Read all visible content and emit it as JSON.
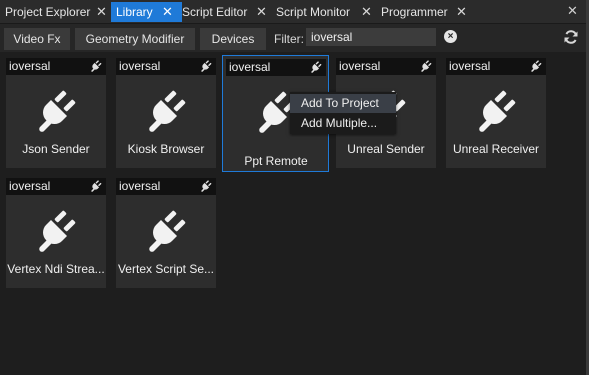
{
  "tabs": [
    {
      "label": "Project Explorer",
      "close": "✕"
    },
    {
      "label": "Library",
      "close": "✕"
    },
    {
      "label": "Script Editor",
      "close": "✕"
    },
    {
      "label": "Script Monitor",
      "close": "✕"
    },
    {
      "label": "Programmer",
      "close": "✕"
    }
  ],
  "window_close": "✕",
  "filters": {
    "buttons": [
      "Video Fx",
      "Geometry Modifier",
      "Devices"
    ],
    "label": "Filter:",
    "value": "ioversal",
    "clear_glyph": "×"
  },
  "cards": [
    {
      "vendor": "ioversal",
      "name": "Json Sender"
    },
    {
      "vendor": "ioversal",
      "name": "Kiosk Browser"
    },
    {
      "vendor": "ioversal",
      "name": "Ppt Remote"
    },
    {
      "vendor": "ioversal",
      "name": "Unreal Sender"
    },
    {
      "vendor": "ioversal",
      "name": "Unreal Receiver"
    },
    {
      "vendor": "ioversal",
      "name": "Vertex Ndi Strea..."
    },
    {
      "vendor": "ioversal",
      "name": "Vertex Script Se..."
    }
  ],
  "context_menu": {
    "items": [
      "Add To Project",
      "Add Multiple..."
    ]
  },
  "colors": {
    "accent": "#1f7ad8",
    "background": "#1e1e1e",
    "card": "#2d2d2d"
  }
}
